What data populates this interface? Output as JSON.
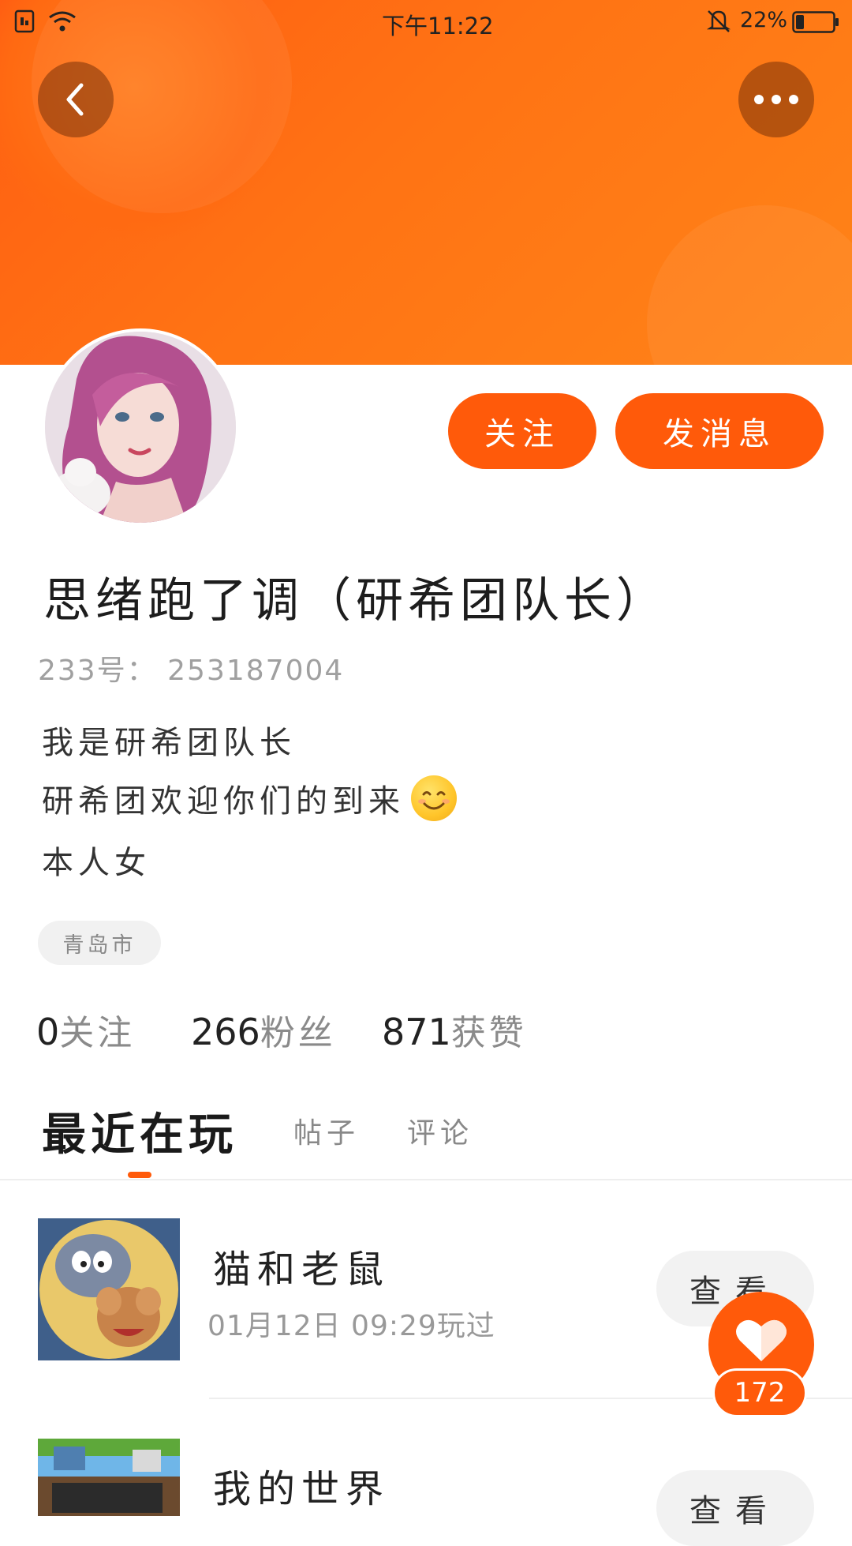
{
  "status_bar": {
    "time": "下午11:22",
    "battery_percent": "22%",
    "battery_level": 0.22,
    "icons": [
      "sim-icon",
      "wifi-icon",
      "bell-muted-icon",
      "battery-icon"
    ]
  },
  "header": {
    "back_icon": "chevron-left-icon",
    "more_icon": "more-dots-icon"
  },
  "profile": {
    "follow_label": "关注",
    "message_label": "发消息",
    "nickname": "思绪跑了调（研希团队长）",
    "account_id": "233号： 253187004",
    "bio": [
      "我是研希团队长",
      "研希团欢迎你们的到来",
      "本人女"
    ],
    "location_tag": "青岛市"
  },
  "stats": [
    {
      "value": "0",
      "label": "关注"
    },
    {
      "value": "266",
      "label": "粉丝"
    },
    {
      "value": "871",
      "label": "获赞"
    }
  ],
  "tabs": [
    "最近在玩",
    "帖子",
    "评论"
  ],
  "games": [
    {
      "name": "猫和老鼠",
      "time": "01月12日 09:29玩过",
      "action": "查看"
    },
    {
      "name": "我的世界",
      "action": "查看"
    }
  ],
  "like": {
    "count": "172"
  },
  "colors": {
    "accent": "#ff5a0a",
    "header_orange": "#ff7314"
  }
}
